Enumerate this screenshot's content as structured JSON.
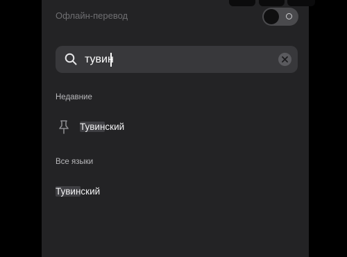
{
  "settings": {
    "offline_label": "Офлайн-перевод",
    "offline_enabled": false
  },
  "search": {
    "value": "тувин"
  },
  "sections": {
    "recent_title": "Недавние",
    "all_title": "Все языки"
  },
  "recent_items": [
    {
      "match": "Тувин",
      "rest": "ский"
    }
  ],
  "all_items": [
    {
      "match": "Тувин",
      "rest": "ский"
    }
  ],
  "icons": {
    "search": "search-icon",
    "clear": "close-icon",
    "toggle_off": "circle-icon",
    "recent": "pin-icon"
  },
  "colors": {
    "panel_bg": "#232325",
    "search_bg": "#38383b",
    "highlight_bg": "#3f3f43"
  }
}
